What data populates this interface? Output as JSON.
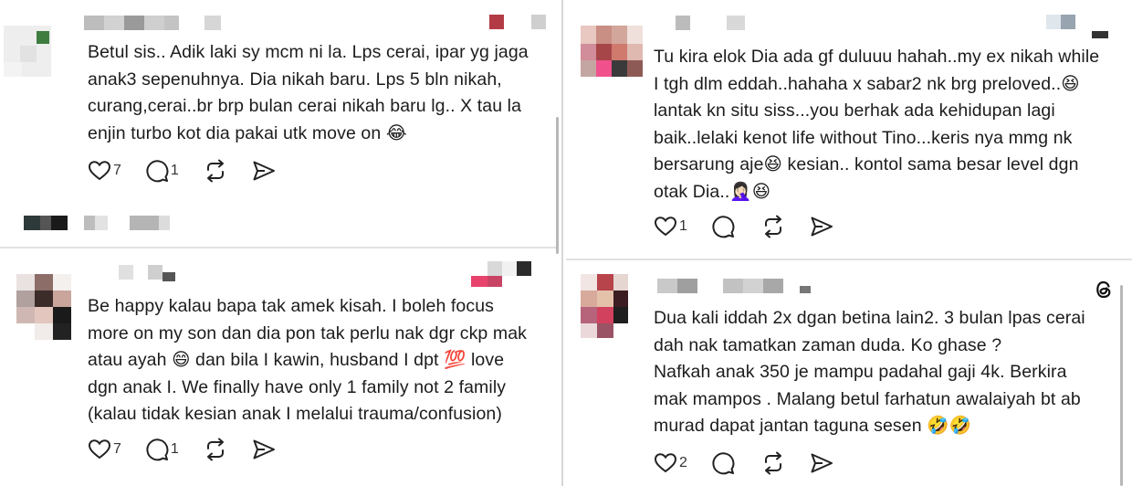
{
  "posts": [
    {
      "body": "Betul sis.. Adik laki sy mcm ni la. Lps cerai, ipar yg jaga\nanak3 sepenuhnya. Dia nikah baru. Lps 5 bln nikah,\ncurang,cerai..br brp bulan cerai nikah baru lg.. X tau la\nenjin turbo kot dia pakai utk move on 😂",
      "likes": "7",
      "replies": "1",
      "icons": [
        "heart-icon",
        "comment-icon",
        "repost-icon",
        "share-icon"
      ]
    },
    {
      "body": "Tu kira elok Dia ada gf duluuu hahah..my ex nikah while\nI tgh dlm eddah..hahaha x sabar2 nk brg preloved..😆\nlantak kn situ siss...you berhak ada kehidupan lagi\nbaik..lelaki kenot life without Tino...keris nya mmg nk\nbersarung aje😆 kesian.. kontol sama besar level dgn\notak Dia..🤦🏻‍♀️😆",
      "likes": "1",
      "replies": "",
      "icons": [
        "heart-icon",
        "comment-icon",
        "repost-icon",
        "share-icon"
      ]
    },
    {
      "body": "Be happy kalau bapa tak amek kisah. I boleh focus\nmore on my son dan dia pon tak perlu nak dgr ckp mak\natau ayah 😄 dan bila I kawin, husband I dpt 💯 love\ndgn anak I. We finally have only 1 family not 2 family\n(kalau tidak kesian anak I melalui trauma/confusion)",
      "likes": "7",
      "replies": "1",
      "icons": [
        "heart-icon",
        "comment-icon",
        "repost-icon",
        "share-icon"
      ]
    },
    {
      "body": "Dua kali iddah 2x dgan betina lain2. 3 bulan lpas cerai\ndah nak tamatkan zaman duda. Ko ghase ?\nNafkah anak 350 je mampu padahal gaji 4k. Berkira\nmak mampos . Malang betul farhatun awalaiyah bt ab\nmurad dapat jantan taguna sesen 🤣🤣",
      "likes": "2",
      "replies": "",
      "icons": [
        "heart-icon",
        "comment-icon",
        "repost-icon",
        "share-icon"
      ]
    }
  ],
  "colors": {
    "text": "#1c1c1c",
    "icon": "#222222",
    "divider": "#d7d7d7"
  },
  "app_icon": "threads-logo-icon"
}
